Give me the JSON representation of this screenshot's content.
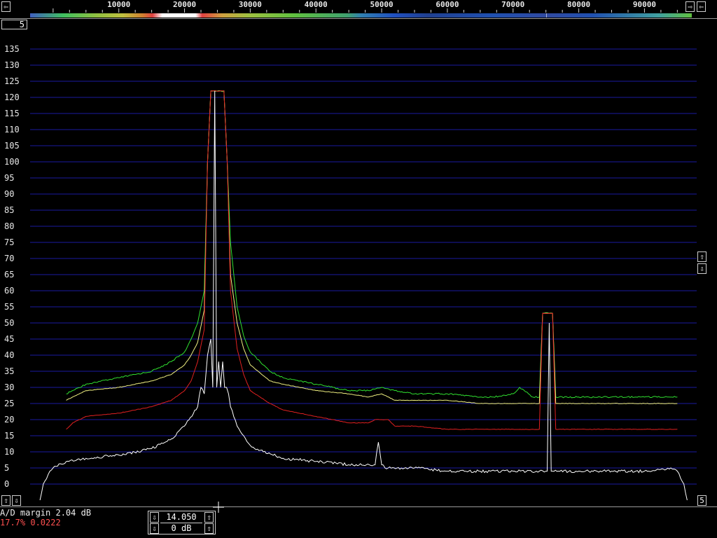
{
  "frequency_axis": {
    "labels": [
      "10000",
      "20000",
      "30000",
      "40000",
      "50000",
      "60000",
      "70000",
      "80000",
      "90000"
    ],
    "values": [
      10000,
      20000,
      30000,
      40000,
      50000,
      60000,
      70000,
      80000,
      90000
    ],
    "min": -3500,
    "max": 97200
  },
  "db_axis": {
    "labels": [
      "135",
      "130",
      "125",
      "120",
      "115",
      "110",
      "105",
      "100",
      "95",
      "90",
      "85",
      "80",
      "75",
      "70",
      "65",
      "60",
      "55",
      "50",
      "45",
      "40",
      "35",
      "30",
      "25",
      "20",
      "15",
      "10",
      "5",
      "0"
    ],
    "min": -5,
    "max": 135
  },
  "top_controls": {
    "left_arrow": "⇦",
    "right_arrow": "⇨",
    "right_back_arrow": "⇦"
  },
  "top_left_box": "5",
  "right_controls": {
    "up_arrow": "⇧",
    "down_arrow": "⇩",
    "bottom_box": "5"
  },
  "bottom_left_controls": {
    "up_arrow": "⇧",
    "down_arrow": "⇩"
  },
  "status": {
    "ad_margin": "A/D margin 2.04 dB",
    "overload": "17.7% 0.0222"
  },
  "center_control": {
    "frequency": "14.050",
    "gain": "0 dB",
    "down_arrow": "⇩",
    "up_arrow": "⇧"
  },
  "colors": {
    "grid": "#1a1aa0",
    "green_trace": "#30e030",
    "yellow_trace": "#f0f080",
    "red_trace": "#e02020",
    "white_trace": "#ffffff",
    "overload_text": "#ff5050"
  },
  "chart_data": {
    "type": "line",
    "xlabel": "",
    "ylabel": "",
    "xlim": [
      -3500,
      97200
    ],
    "ylim": [
      -5,
      135
    ],
    "grid": true,
    "series": [
      {
        "color": "green",
        "x": [
          2000,
          5000,
          10000,
          15000,
          18000,
          20000,
          21000,
          22000,
          23000,
          23500,
          24000,
          24500,
          25500,
          26000,
          26500,
          27000,
          28000,
          29000,
          30000,
          33000,
          35000,
          40000,
          45000,
          48000,
          50000,
          52000,
          55000,
          60000,
          65000,
          67000,
          70000,
          71000,
          73000,
          74000,
          74500,
          75500,
          76000,
          76500,
          77000,
          80000,
          85000,
          90000,
          95000
        ],
        "y": [
          28,
          31,
          33,
          35,
          38,
          41,
          45,
          50,
          60,
          100,
          122,
          122,
          122,
          122,
          100,
          75,
          55,
          46,
          41,
          35,
          33,
          31,
          29,
          29,
          30,
          29,
          28,
          28,
          27,
          27,
          28,
          30,
          27,
          27,
          53,
          53,
          53,
          27,
          27,
          27,
          27,
          27,
          27
        ]
      },
      {
        "color": "yellow",
        "x": [
          2000,
          5000,
          10000,
          15000,
          18000,
          20000,
          21000,
          22000,
          23000,
          23500,
          24000,
          24500,
          25500,
          26000,
          26500,
          27000,
          28000,
          29000,
          30000,
          33000,
          35000,
          40000,
          45000,
          48000,
          50000,
          52000,
          55000,
          60000,
          65000,
          70000,
          73000,
          74000,
          74500,
          75500,
          76000,
          76500,
          77000,
          80000,
          85000,
          90000,
          95000
        ],
        "y": [
          26,
          29,
          30,
          32,
          34,
          37,
          40,
          44,
          54,
          100,
          122,
          122,
          122,
          122,
          100,
          65,
          50,
          42,
          37,
          32,
          31,
          29,
          28,
          27,
          28,
          26,
          26,
          26,
          25,
          25,
          25,
          25,
          53,
          53,
          53,
          25,
          25,
          25,
          25,
          25,
          25
        ]
      },
      {
        "color": "red",
        "x": [
          2000,
          3000,
          5000,
          10000,
          15000,
          18000,
          20000,
          21000,
          22000,
          23000,
          23500,
          24000,
          24500,
          25500,
          26000,
          26500,
          27000,
          28000,
          29000,
          30000,
          33000,
          35000,
          40000,
          45000,
          48000,
          49000,
          50000,
          51000,
          52000,
          55000,
          60000,
          65000,
          70000,
          73000,
          74000,
          74500,
          75500,
          76000,
          76500,
          77000,
          80000,
          85000,
          90000,
          95000
        ],
        "y": [
          17,
          19,
          21,
          22,
          24,
          26,
          29,
          32,
          38,
          48,
          100,
          122,
          122,
          122,
          122,
          100,
          60,
          42,
          34,
          29,
          25,
          23,
          21,
          19,
          19,
          20,
          20,
          20,
          18,
          18,
          17,
          17,
          17,
          17,
          17,
          53,
          53,
          53,
          17,
          17,
          17,
          17,
          17,
          17
        ]
      },
      {
        "color": "white",
        "x": [
          -2000,
          -1500,
          -500,
          0,
          2000,
          5000,
          10000,
          15000,
          18000,
          20000,
          22000,
          22500,
          23000,
          23500,
          24000,
          24300,
          24600,
          24900,
          25200,
          25500,
          25800,
          26100,
          26400,
          26700,
          27000,
          28000,
          29000,
          30000,
          32000,
          35000,
          40000,
          45000,
          49000,
          49500,
          50000,
          50500,
          51000,
          55000,
          60000,
          65000,
          70000,
          74000,
          75000,
          75200,
          75500,
          75800,
          76000,
          80000,
          85000,
          90000,
          94000,
          95000,
          96000,
          96500
        ],
        "y": [
          -5,
          0,
          4,
          5,
          7,
          8,
          9,
          11,
          14,
          18,
          24,
          30,
          28,
          40,
          45,
          30,
          122,
          30,
          38,
          30,
          38,
          30,
          30,
          28,
          24,
          18,
          15,
          12,
          10,
          8,
          7,
          6,
          6,
          13,
          6,
          5,
          5,
          5,
          4,
          4,
          4,
          4,
          4,
          4,
          50,
          4,
          4,
          4,
          4,
          4,
          5,
          4,
          0,
          -5
        ]
      }
    ]
  }
}
